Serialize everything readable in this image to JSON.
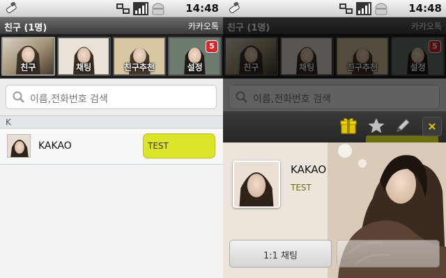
{
  "statusbar": {
    "time": "14:48",
    "icons": [
      "usb-icon",
      "network-sync-icon",
      "signal-icon",
      "android-icon"
    ]
  },
  "titlebar": {
    "title": "친구 (1명)",
    "brand": "카카오톡"
  },
  "tabs": [
    {
      "label": "친구",
      "icon": "profile-photo"
    },
    {
      "label": "채팅",
      "icon": "profile-photo"
    },
    {
      "label": "친구추천",
      "icon": "profile-photo"
    },
    {
      "label": "설정",
      "icon": "profile-photo",
      "badge": "5"
    }
  ],
  "search": {
    "placeholder": "이름,전화번호 검색"
  },
  "list": {
    "section": "K",
    "friends": [
      {
        "name": "KAKAO",
        "status": "TEST"
      }
    ]
  },
  "profile_popup": {
    "actions": [
      "gift-icon",
      "star-icon",
      "pencil-icon",
      "close-icon"
    ],
    "close_label": "×",
    "name": "KAKAO",
    "status": "TEST",
    "chat_button": "1:1 채팅",
    "second_button": ""
  },
  "colors": {
    "status_bubble": "#dde42a",
    "badge": "#d9262b",
    "close_accent": "#e8d000"
  }
}
